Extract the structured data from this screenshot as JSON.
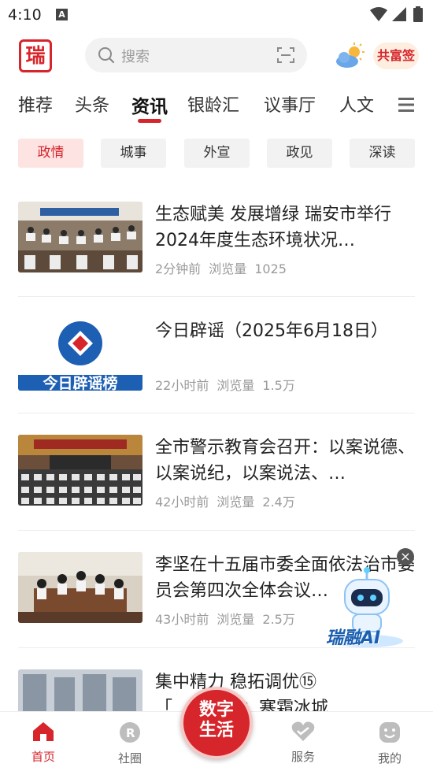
{
  "status": {
    "time": "4:10",
    "notif_icon": "A"
  },
  "header": {
    "logo_text": "瑞",
    "search_placeholder": "搜索",
    "gxq_text": "共富签"
  },
  "channels": [
    "推荐",
    "头条",
    "资讯",
    "银龄汇",
    "议事厅",
    "人文"
  ],
  "channels_active": "资讯",
  "subtabs": [
    "政情",
    "城事",
    "外宣",
    "政见",
    "深读"
  ],
  "subtabs_active": "政情",
  "news": [
    {
      "title": "生态赋美 发展增绿 瑞安市举行2024年度生态环境状况…",
      "time": "2分钟前",
      "views_label": "浏览量",
      "views": "1025"
    },
    {
      "title": "今日辟谣（2025年6月18日）",
      "time": "22小时前",
      "views_label": "浏览量",
      "views": "1.5万",
      "thumb_text": "今日辟谣榜"
    },
    {
      "title": "全市警示教育会召开：以案说德、以案说纪，以案说法、…",
      "time": "42小时前",
      "views_label": "浏览量",
      "views": "2.4万"
    },
    {
      "title": "李坚在十五届市委全面依法治市委员会第四次全体会议…",
      "time": "43小时前",
      "views_label": "浏览量",
      "views": "2.5万"
    },
    {
      "title": "集中精力 稳拓调优⑮",
      "subtitle": "「…」瑞麦：寒霜冰城…",
      "time": "",
      "views_label": "",
      "views": ""
    }
  ],
  "ai_float": {
    "label": "瑞融AI",
    "close": "×"
  },
  "bottomnav": {
    "home": "首页",
    "circle": "社圈",
    "center": "数字生活",
    "service": "服务",
    "mine": "我的"
  },
  "colors": {
    "accent": "#d6252b",
    "chip_active_bg": "#fde4e3",
    "chip_bg": "#f2f2f2"
  }
}
